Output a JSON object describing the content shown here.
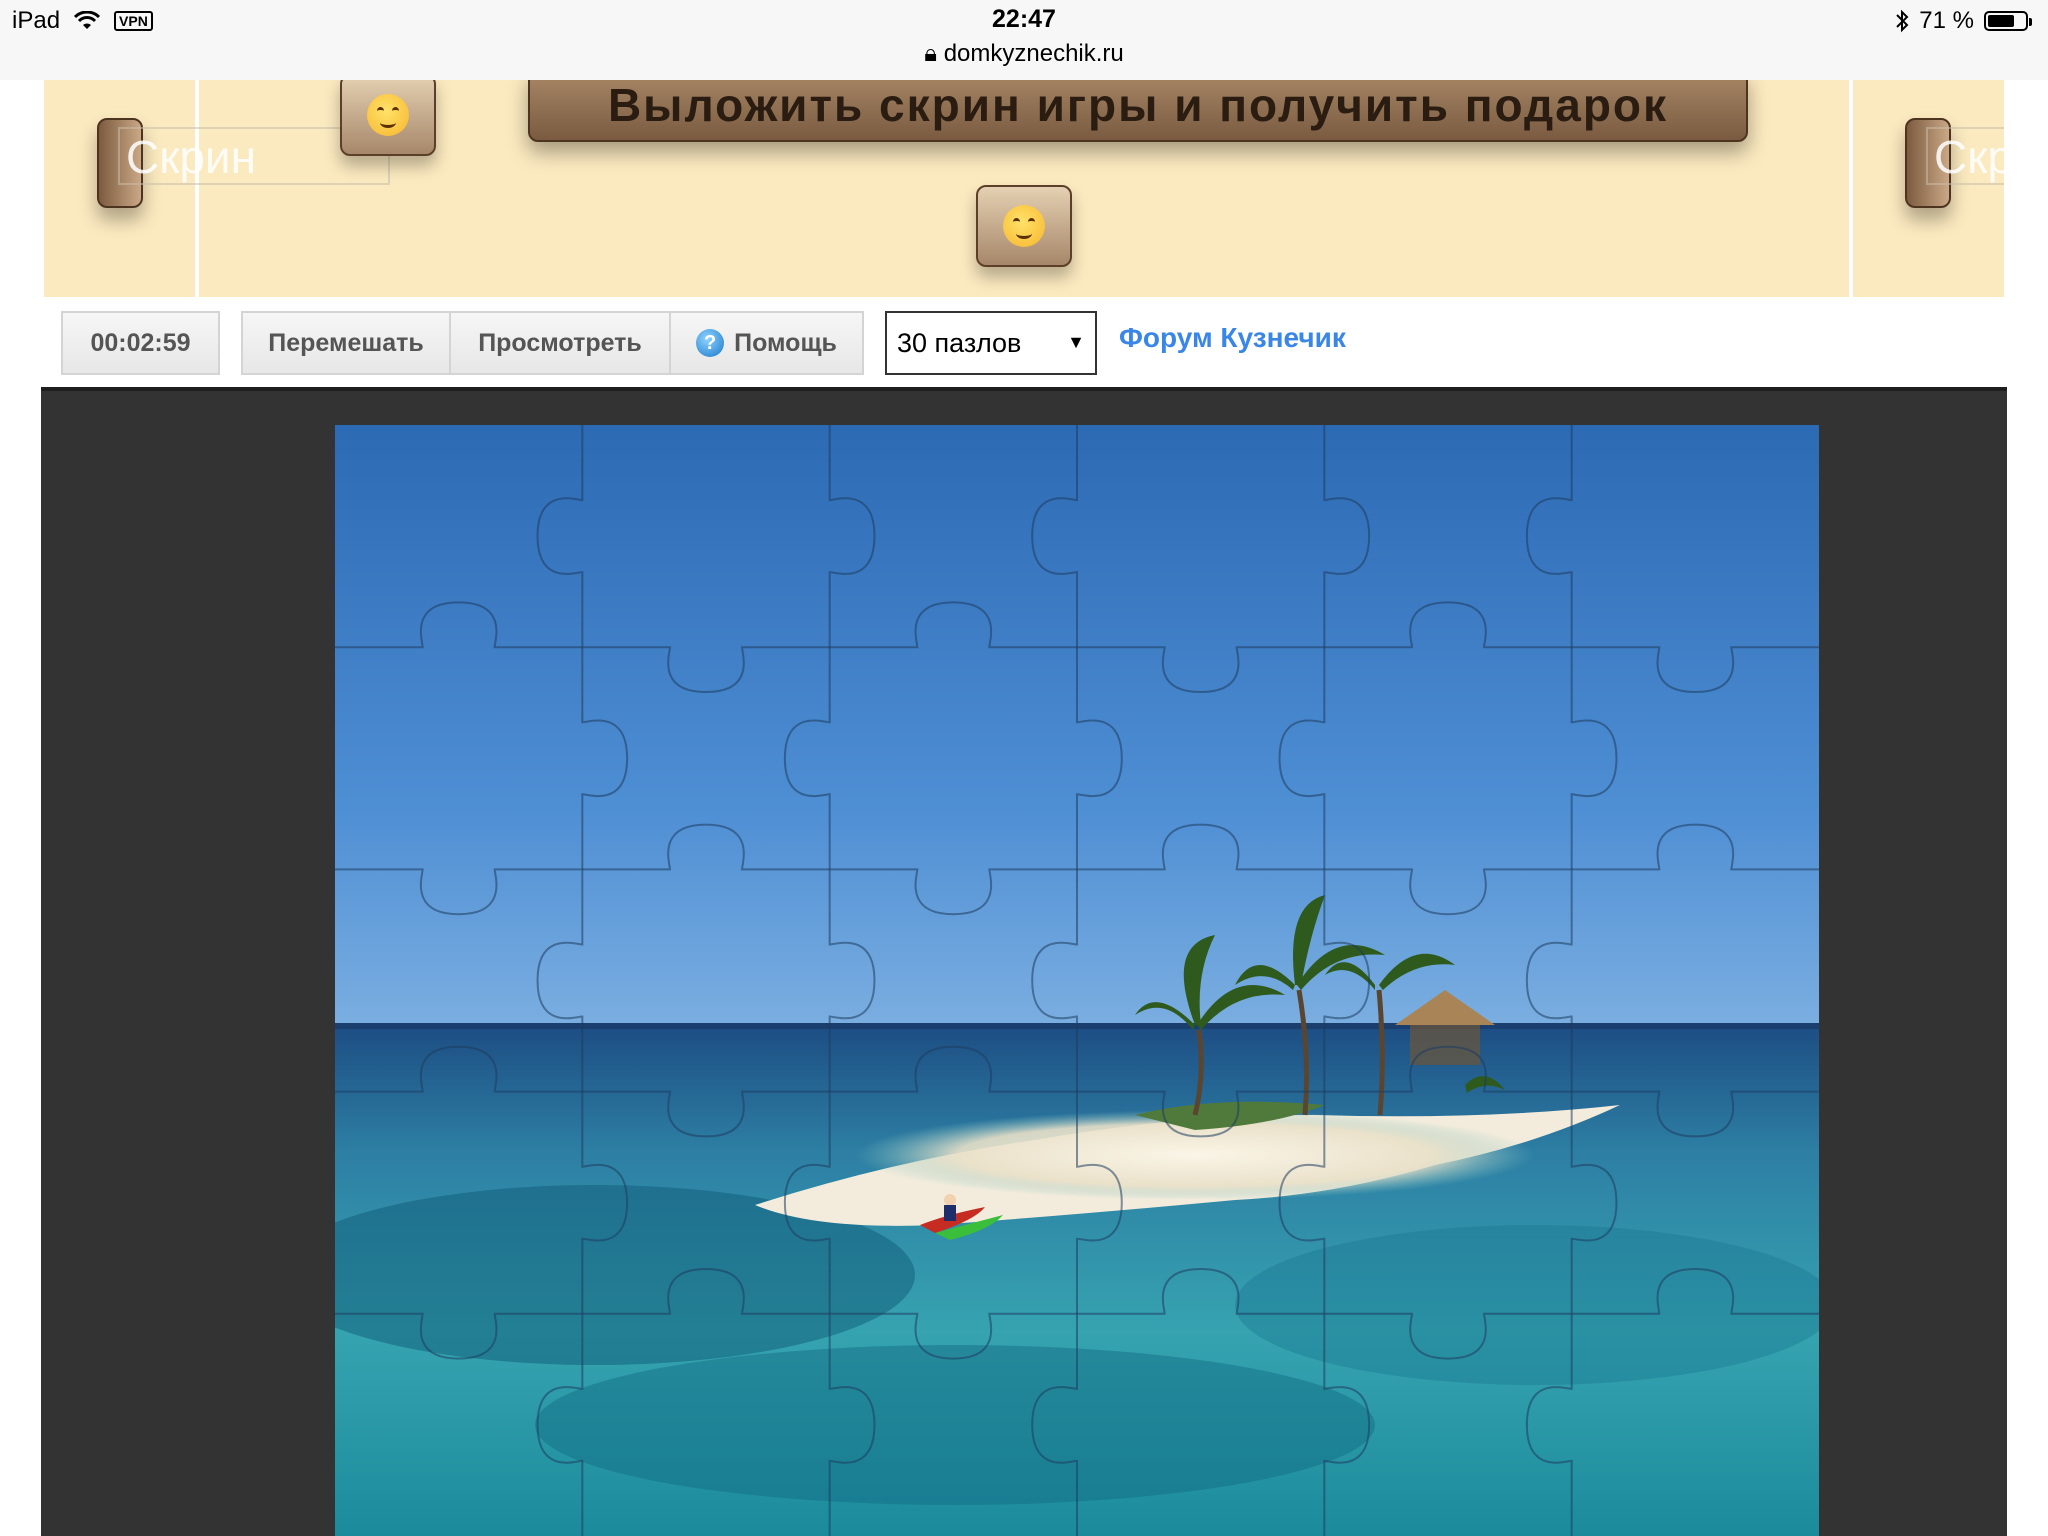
{
  "status_bar": {
    "device": "iPad",
    "vpn": "VPN",
    "time": "22:47",
    "url": "domkyznechik.ru",
    "battery_text": "71 %",
    "battery_level": 0.71
  },
  "banner": {
    "promo_text": "Выложить скрин игры и получить подарок",
    "screen_label": "Скрин",
    "screen_label_right": "Скр"
  },
  "toolbar": {
    "timer": "00:02:59",
    "shuffle": "Перемешать",
    "preview": "Просмотреть",
    "help": "Помощь",
    "pieces_selected": "30 пазлов",
    "forum": "Форум Кузнечик"
  },
  "puzzle": {
    "columns": 6,
    "rows": 5,
    "image": "tropical-island-beach"
  },
  "colors": {
    "banner_bg": "#fbe9bf",
    "promo_bg": "#8f6f52",
    "link": "#3a86e8",
    "game_bg": "#333333"
  }
}
